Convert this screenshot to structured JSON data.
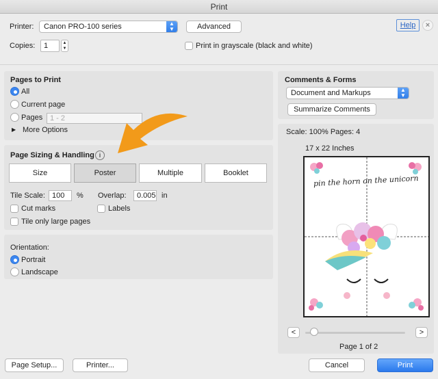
{
  "window": {
    "title": "Print"
  },
  "header": {
    "printer_label": "Printer:",
    "printer_value": "Canon PRO-100 series",
    "advanced_label": "Advanced",
    "help_label": "Help",
    "copies_label": "Copies:",
    "copies_value": "1",
    "grayscale_label": "Print in grayscale (black and white)"
  },
  "pages_to_print": {
    "title": "Pages to Print",
    "options": [
      "All",
      "Current page",
      "Pages"
    ],
    "selected": "All",
    "pages_placeholder": "1 - 2",
    "more_options_label": "More Options"
  },
  "sizing": {
    "title": "Page Sizing & Handling",
    "tabs": [
      "Size",
      "Poster",
      "Multiple",
      "Booklet"
    ],
    "selected_tab": "Poster",
    "tile_scale_label": "Tile Scale:",
    "tile_scale_value": "100",
    "tile_scale_unit": "%",
    "overlap_label": "Overlap:",
    "overlap_value": "0.005",
    "overlap_unit": "in",
    "cut_marks_label": "Cut marks",
    "labels_label": "Labels",
    "tile_large_label": "Tile only large pages"
  },
  "orientation": {
    "title": "Orientation:",
    "options": [
      "Portrait",
      "Landscape"
    ],
    "selected": "Portrait"
  },
  "comments": {
    "title": "Comments & Forms",
    "select_value": "Document and Markups",
    "summarize_label": "Summarize Comments"
  },
  "preview": {
    "scale_text": "Scale: 100% Pages: 4",
    "size_text": "17 x 22 Inches",
    "page_indicator": "Page 1 of 2",
    "prev_label": "<",
    "next_label": ">",
    "artwork_text": "pin the horn on the unicorn"
  },
  "footer": {
    "page_setup_label": "Page Setup...",
    "printer_label": "Printer...",
    "cancel_label": "Cancel",
    "print_label": "Print"
  },
  "colors": {
    "accent": "#2f7de8",
    "arrow": "#f29a1a"
  }
}
